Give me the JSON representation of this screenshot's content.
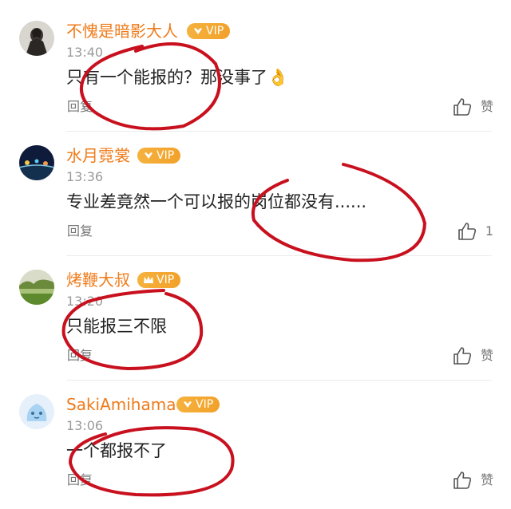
{
  "comments": [
    {
      "username": "不愧是暗影大人",
      "vip": "VIP",
      "time": "13:40",
      "text": "只有一个能报的？那没事了👌",
      "reply": "回复",
      "like": "赞"
    },
    {
      "username": "水月霓裳",
      "vip": "VIP",
      "time": "13:36",
      "text": "专业差竟然一个可以报的岗位都没有......",
      "reply": "回复",
      "like": "1"
    },
    {
      "username": "烤鞭大叔",
      "vip": "VIP",
      "time": "13:20",
      "text": "只能报三不限",
      "reply": "回复",
      "like": "赞"
    },
    {
      "username": "SakiAmihama",
      "vip": "VIP",
      "time": "13:06",
      "text": "一个都报不了",
      "reply": "回复",
      "like": "赞"
    }
  ],
  "colors": {
    "username": "#ef7b1a",
    "vip_badge": "#f2a12a",
    "annotation": "#c8101e"
  },
  "icons": {
    "like": "thumbs-up-icon",
    "vip": "crown-icon"
  }
}
